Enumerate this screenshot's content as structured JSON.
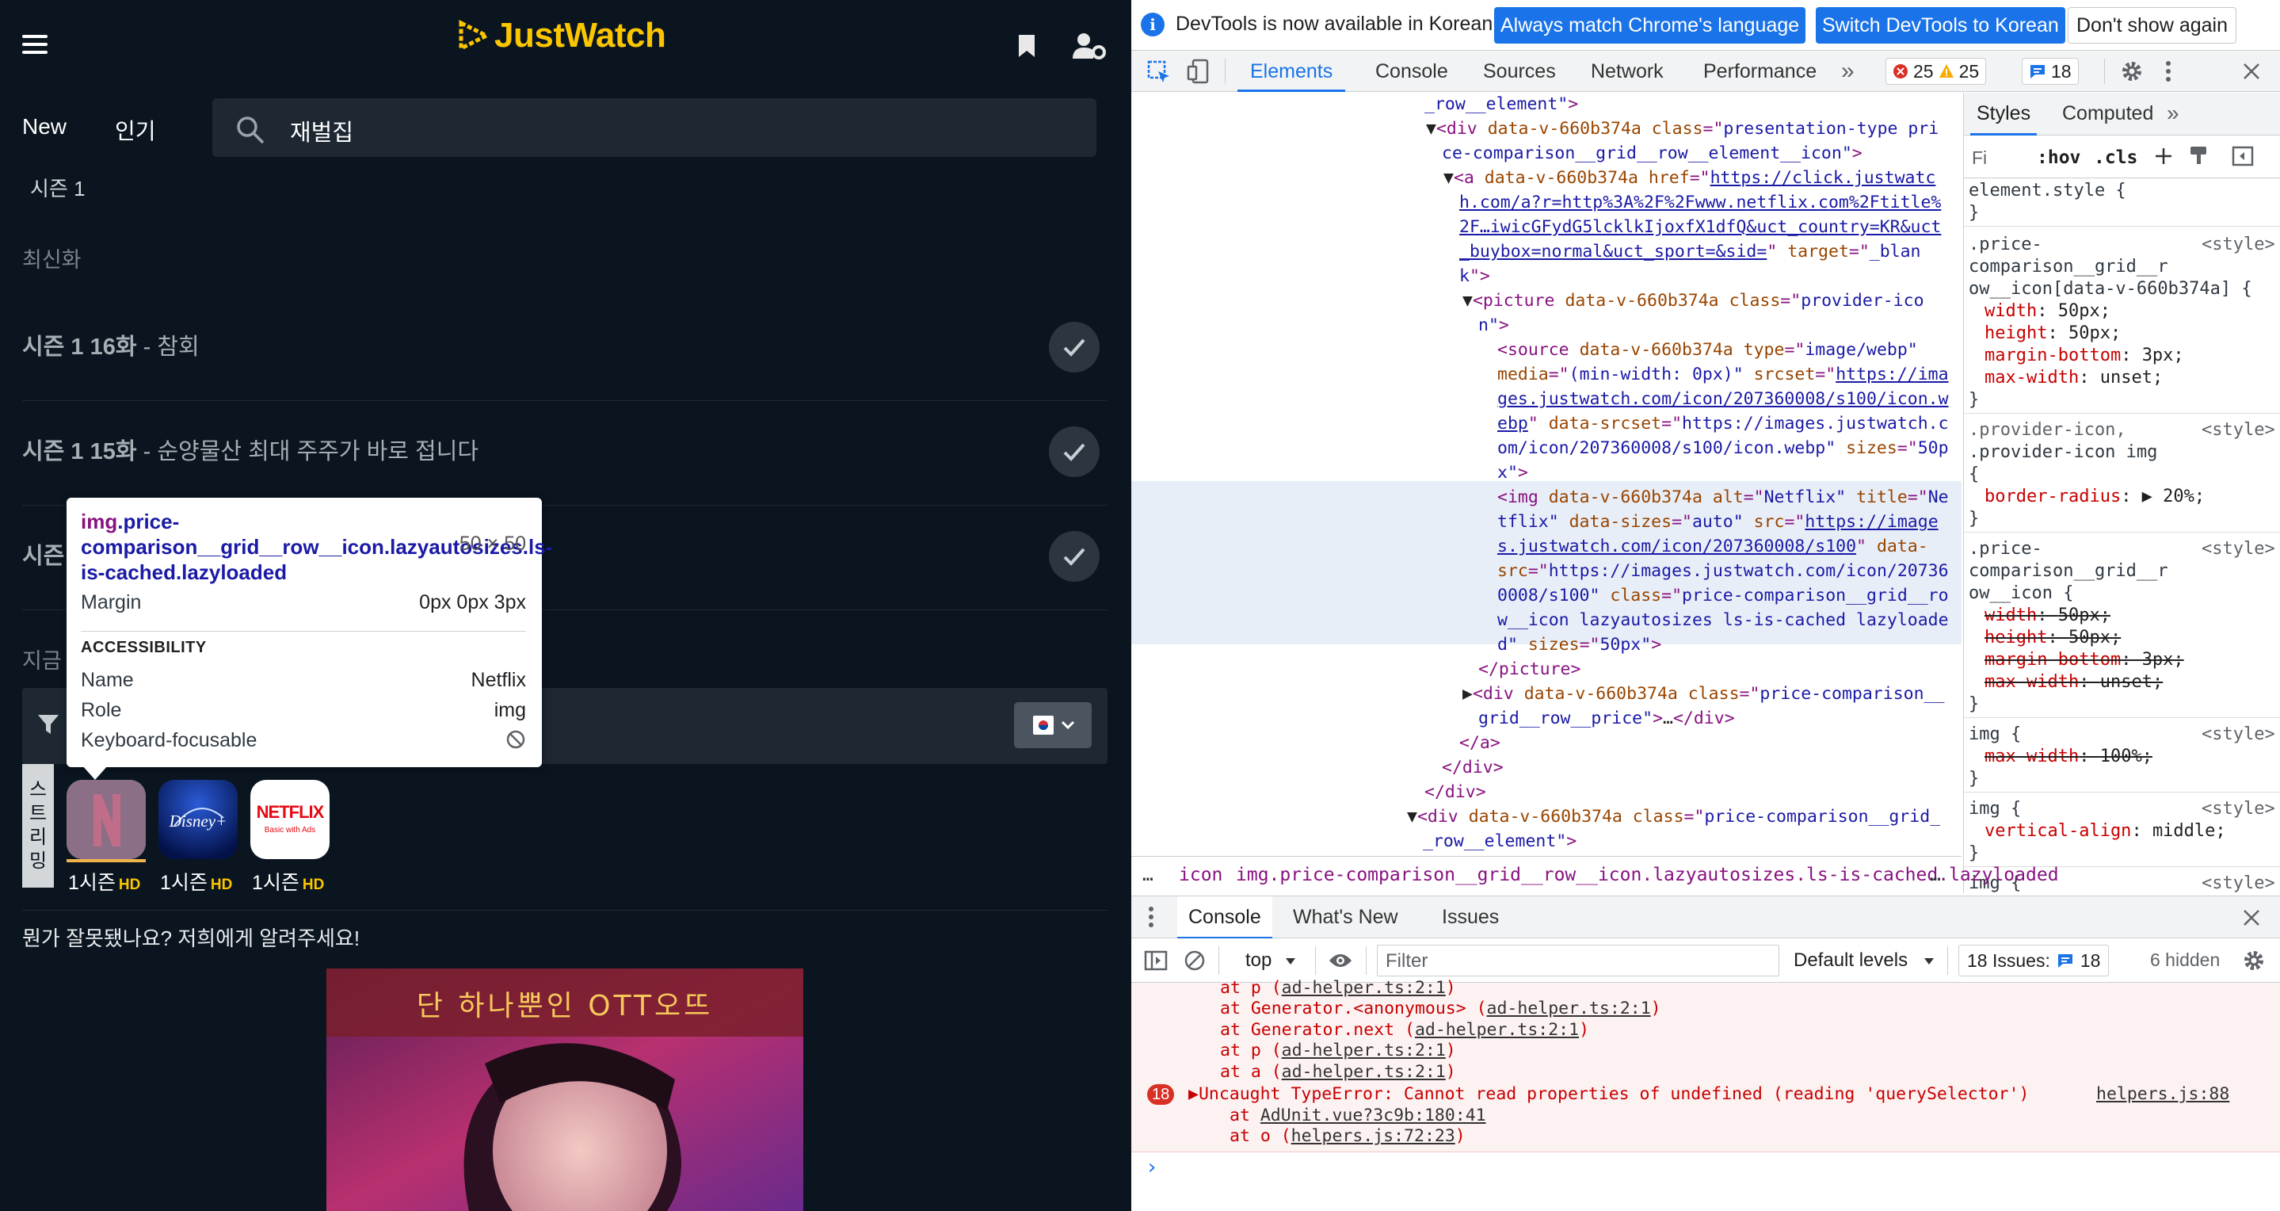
{
  "page": {
    "logo": "JustWatch",
    "nav": {
      "new": "New",
      "popular": "인기"
    },
    "search": {
      "value": "재벌집"
    },
    "season_tab": "시즌 1",
    "latest_label": "최신화",
    "episodes": [
      {
        "code": "시즌 1 16화",
        "title": "참회"
      },
      {
        "code": "시즌 1 15화",
        "title": "순양물산 최대 주주가 바로 접니다"
      },
      {
        "code": "시즌"
      }
    ],
    "now_label": "지금",
    "stream_label": [
      "스",
      "트",
      "리",
      "밍"
    ],
    "providers": [
      {
        "icon": "netflix-n-icon",
        "season": "1시즌",
        "quality": "HD"
      },
      {
        "icon": "disney-plus-icon",
        "name": "Disney+",
        "season": "1시즌",
        "quality": "HD"
      },
      {
        "icon": "netflix-basic-ads-icon",
        "name": "NETFLIX",
        "sub": "Basic with Ads",
        "season": "1시즌",
        "quality": "HD"
      }
    ],
    "feedback": "뭔가 잘못됐나요? 저희에게 알려주세요!",
    "ad_banner": "단 하나뿐인 OTT오뜨"
  },
  "tooltip": {
    "selector_tag": "img",
    "selector_rest": ".price-comparison__grid__row__icon.lazyautosizes.ls-is-cached.lazyloaded",
    "dims": "50 × 50",
    "margin_label": "Margin",
    "margin_value": "0px 0px 3px",
    "accessibility": "ACCESSIBILITY",
    "name_label": "Name",
    "name_value": "Netflix",
    "role_label": "Role",
    "role_value": "img",
    "focus_label": "Keyboard-focusable"
  },
  "devtools": {
    "infobar": {
      "message": "DevTools is now available in Korean!",
      "btn_match": "Always match Chrome's language",
      "btn_switch": "Switch DevTools to Korean",
      "btn_dismiss": "Don't show again"
    },
    "tabs": [
      "Elements",
      "Console",
      "Sources",
      "Network",
      "Performance"
    ],
    "more_tabs": "»",
    "errors": "25",
    "warnings": "25",
    "issues": "18",
    "styles_tabs": [
      "Styles",
      "Computed"
    ],
    "styles_filter": "Fi",
    "hov": ":hov",
    "cls": ".cls",
    "breadcrumb": [
      "icon",
      "img.price-comparison__grid__row__icon.lazyautosizes.ls-is-cached.lazyloaded"
    ],
    "breadcrumb_more": "…",
    "drawer_tabs": [
      "Console",
      "What's New",
      "Issues"
    ],
    "console_context": "top",
    "console_filter_placeholder": "Filter",
    "levels": "Default levels",
    "issues_count_label": "18 Issues:",
    "issues_count": "18",
    "hidden": "6 hidden",
    "error_count": "18",
    "error_message": "Uncaught TypeError: Cannot read properties of undefined (reading 'querySelector')",
    "error_source": "helpers.js:88",
    "prompt": "›"
  },
  "colors": {
    "brand": "#fbc500",
    "page_bg": "#0a151f",
    "accent": "#1a73e8",
    "error": "#c80000"
  }
}
